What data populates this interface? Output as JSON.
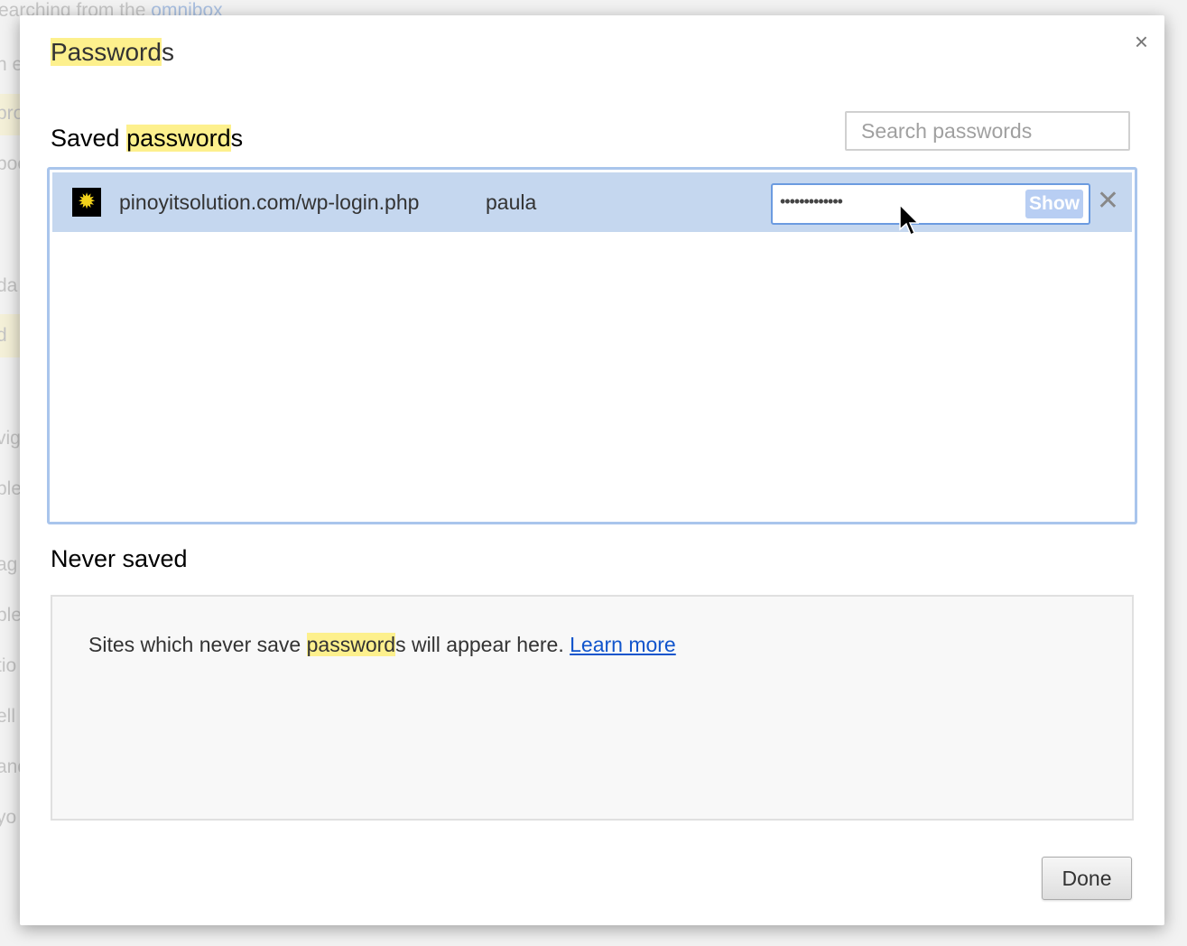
{
  "background": {
    "fragments": [
      "earching from the ",
      "omnibox",
      "n e",
      "pro",
      "boo",
      "da",
      "d",
      "vig",
      "ple",
      "ag",
      "ple",
      "tio",
      "ell",
      "and",
      "yo"
    ]
  },
  "dialog": {
    "title": {
      "highlight": "Password",
      "rest": "s"
    },
    "close_icon": "×",
    "saved": {
      "heading_prefix": "Saved ",
      "heading_highlight": "password",
      "heading_suffix": "s",
      "search_placeholder": "Search passwords",
      "rows": [
        {
          "site": "pinoyitsolution.com/wp-login.php",
          "username": "paula",
          "password_masked": "•••••••••••••",
          "show_label": "Show",
          "favicon": "sun-icon"
        }
      ]
    },
    "never": {
      "heading": "Never saved",
      "text_prefix": "Sites which never save ",
      "text_highlight": "password",
      "text_suffix": "s will appear here. ",
      "learn_more": "Learn more"
    },
    "done_label": "Done"
  },
  "colors": {
    "highlight": "#fdf08d",
    "selected_row": "#c5d7ef",
    "link": "#1155cc"
  }
}
